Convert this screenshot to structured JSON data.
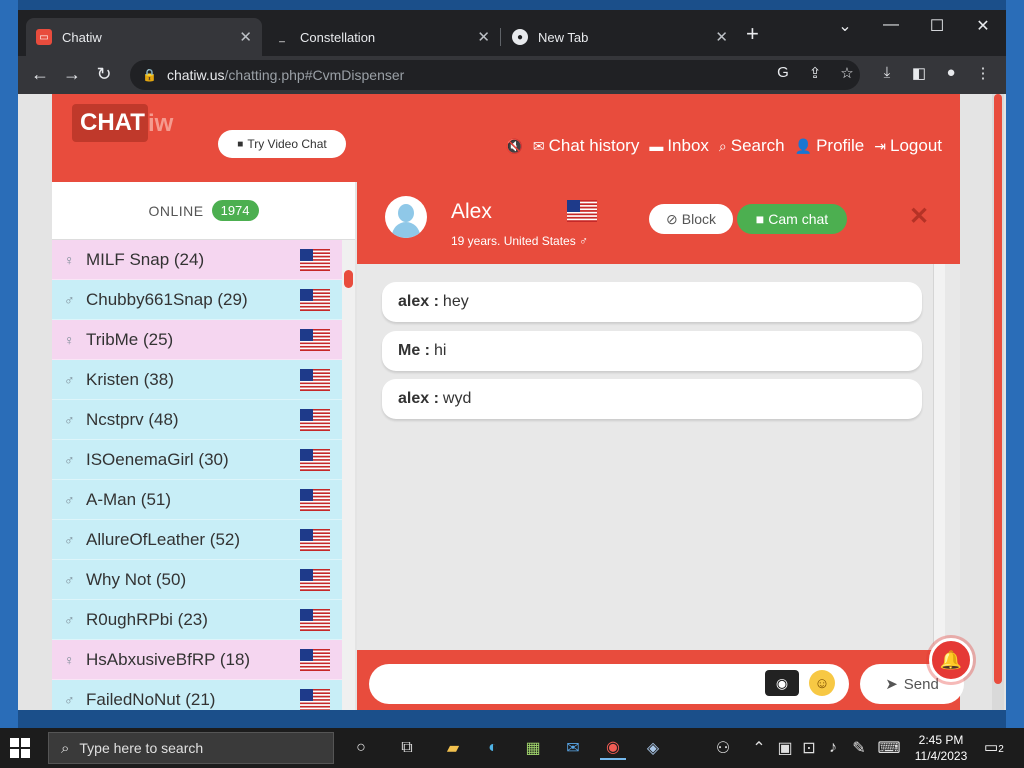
{
  "browser": {
    "tabs": [
      {
        "label": "Chatiw",
        "icon": "chatiw-favicon",
        "active": true
      },
      {
        "label": "Constellation",
        "icon": "constellation-favicon",
        "active": false
      },
      {
        "label": "New Tab",
        "icon": "chrome-favicon",
        "active": false
      }
    ],
    "url_host": "chatiw.us",
    "url_path": "/chatting.php#CvmDispenser"
  },
  "site": {
    "logo_main": "CHAT",
    "logo_tail": "iw",
    "try_video": "Try Video Chat",
    "nav": [
      {
        "label": "",
        "icon": "mute-icon"
      },
      {
        "label": "Chat history",
        "icon": "envelope-icon"
      },
      {
        "label": "Inbox",
        "icon": "speech-bubble-icon"
      },
      {
        "label": "Search",
        "icon": "search-icon"
      },
      {
        "label": "Profile",
        "icon": "person-icon"
      },
      {
        "label": "Logout",
        "icon": "logout-icon"
      }
    ]
  },
  "sidebar": {
    "online_label": "ONLINE",
    "online_count": "1974",
    "users": [
      {
        "name": "MILF Snap (24)",
        "gender": "female"
      },
      {
        "name": "Chubby661Snap (29)",
        "gender": "male"
      },
      {
        "name": "TribMe (25)",
        "gender": "female"
      },
      {
        "name": "Kristen (38)",
        "gender": "male"
      },
      {
        "name": "Ncstprv (48)",
        "gender": "male"
      },
      {
        "name": "ISOenemaGirl (30)",
        "gender": "male"
      },
      {
        "name": "A-Man (51)",
        "gender": "male"
      },
      {
        "name": "AllureOfLeather (52)",
        "gender": "male"
      },
      {
        "name": "Why Not (50)",
        "gender": "male"
      },
      {
        "name": "R0ughRPbi (23)",
        "gender": "male"
      },
      {
        "name": "HsAbxusiveBfRP (18)",
        "gender": "female"
      },
      {
        "name": "FailedNoNut (21)",
        "gender": "male"
      }
    ]
  },
  "chat": {
    "name": "Alex",
    "subtitle": "19 years. United States ♂",
    "block_label": "Block",
    "cam_label": "Cam chat",
    "messages": [
      {
        "sender": "alex :",
        "text": "hey"
      },
      {
        "sender": "Me :",
        "text": "hi"
      },
      {
        "sender": "alex :",
        "text": "wyd"
      }
    ],
    "send_label": "Send",
    "input_value": ""
  },
  "taskbar": {
    "search_placeholder": "Type here to search",
    "time": "2:45 PM",
    "date": "11/4/2023",
    "notifications": "2"
  },
  "colors": {
    "brand": "#e84c3d",
    "online_badge": "#4caf50",
    "male_row": "#c8eef7",
    "female_row": "#f5d6f0"
  }
}
